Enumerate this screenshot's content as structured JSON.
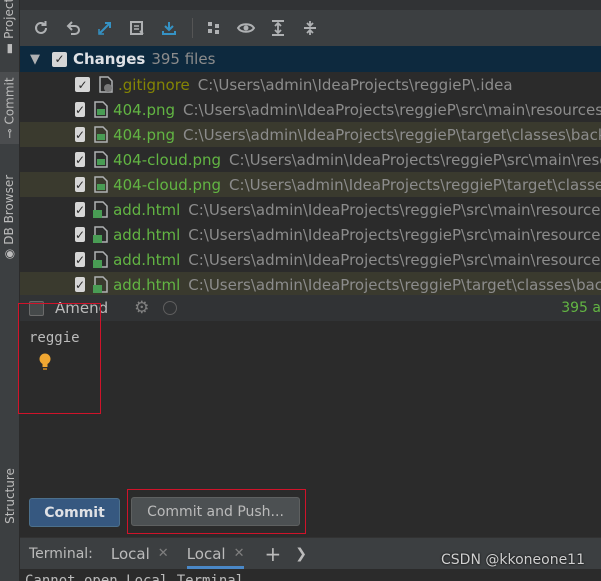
{
  "sidebar": {
    "tabs": [
      {
        "label": "Project"
      },
      {
        "label": "Commit"
      },
      {
        "label": "DB Browser"
      },
      {
        "label": "Structure"
      }
    ]
  },
  "toolbar": {
    "icons": [
      "refresh-icon",
      "rollback-icon",
      "diff-icon",
      "changelist-icon",
      "update-icon",
      "group-icon",
      "preview-icon",
      "expand-all-icon",
      "collapse-all-icon"
    ]
  },
  "changes": {
    "title": "Changes",
    "count": "395 files"
  },
  "files": [
    {
      "name": ".gitignore",
      "path": "C:\\Users\\admin\\IdeaProjects\\reggieP\\.idea",
      "ignored": true
    },
    {
      "name": "404.png",
      "path": "C:\\Users\\admin\\IdeaProjects\\reggieP\\src\\main\\resources",
      "ignored": false
    },
    {
      "name": "404.png",
      "path": "C:\\Users\\admin\\IdeaProjects\\reggieP\\target\\classes\\back",
      "ignored": false
    },
    {
      "name": "404-cloud.png",
      "path": "C:\\Users\\admin\\IdeaProjects\\reggieP\\src\\main\\reso",
      "ignored": false
    },
    {
      "name": "404-cloud.png",
      "path": "C:\\Users\\admin\\IdeaProjects\\reggieP\\target\\classe",
      "ignored": false
    },
    {
      "name": "add.html",
      "path": "C:\\Users\\admin\\IdeaProjects\\reggieP\\src\\main\\resources",
      "ignored": false
    },
    {
      "name": "add.html",
      "path": "C:\\Users\\admin\\IdeaProjects\\reggieP\\src\\main\\resources",
      "ignored": false
    },
    {
      "name": "add.html",
      "path": "C:\\Users\\admin\\IdeaProjects\\reggieP\\src\\main\\resources",
      "ignored": false
    },
    {
      "name": "add.html",
      "path": "C:\\Users\\admin\\IdeaProjects\\reggieP\\target\\classes\\bac",
      "ignored": false
    }
  ],
  "amend": {
    "label": "Amend",
    "count": "395 a"
  },
  "message": {
    "text": "reggie"
  },
  "buttons": {
    "commit": "Commit",
    "commit_and_push": "Commit and Push..."
  },
  "terminal": {
    "title": "Terminal:",
    "tabs": [
      {
        "label": "Local"
      },
      {
        "label": "Local"
      }
    ],
    "output": "Cannot open Local Terminal"
  },
  "watermark": "CSDN @kkoneone11",
  "colors": {
    "selected_header": "#0d293e",
    "added_file": "#62b543",
    "primary_button": "#365880",
    "highlight_box": "#d0132a"
  }
}
